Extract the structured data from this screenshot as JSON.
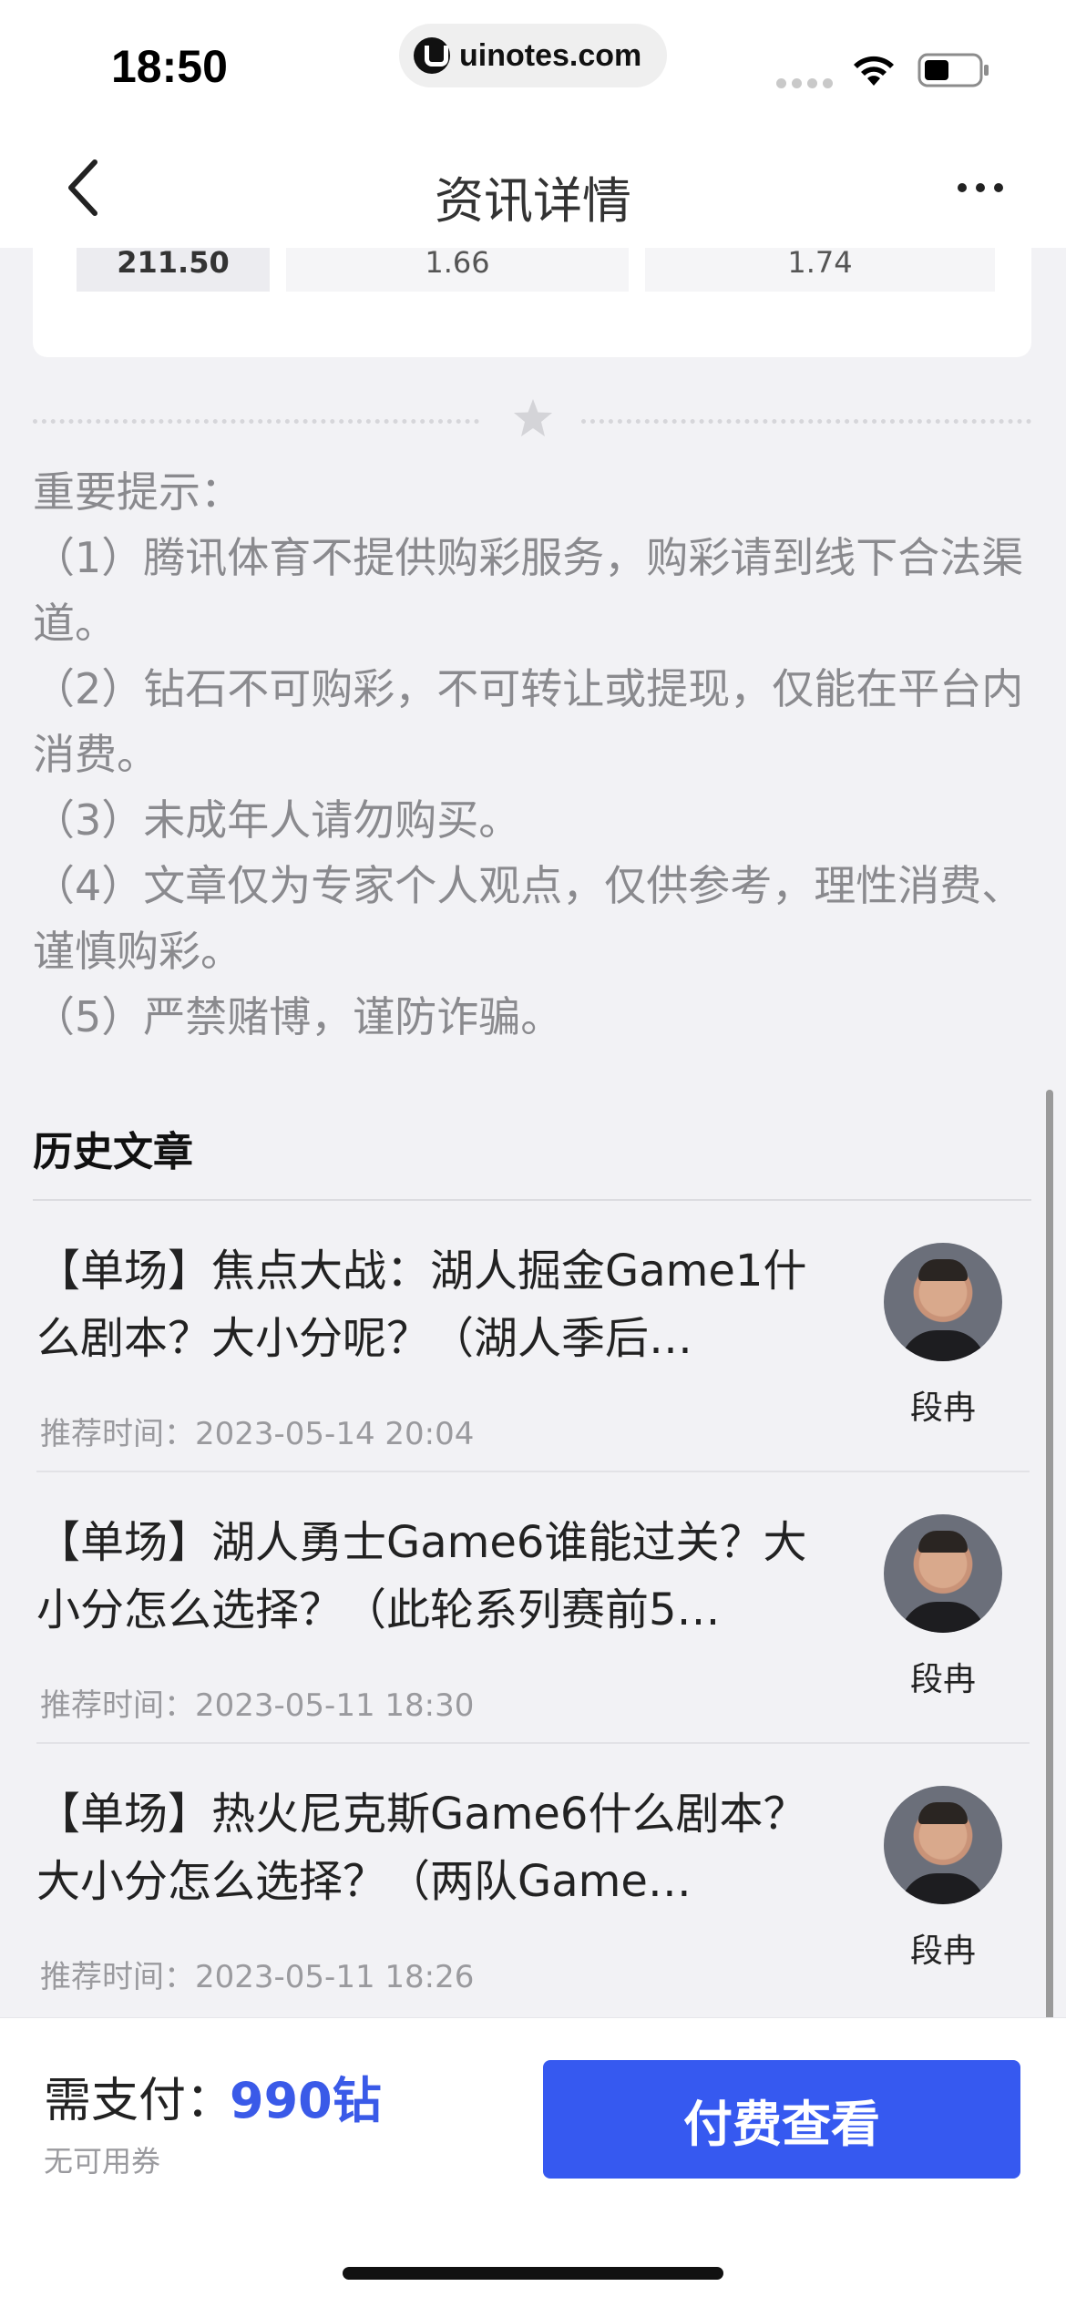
{
  "status_bar": {
    "time": "18:50",
    "url": "uinotes.com"
  },
  "nav": {
    "title": "资讯详情"
  },
  "odds_row": [
    "211.50",
    "1.66",
    "1.74"
  ],
  "notice": {
    "lines": [
      "重要提示：",
      "（1）腾讯体育不提供购彩服务，购彩请到线下合法渠道。",
      "（2）钻石不可购彩，不可转让或提现，仅能在平台内消费。",
      "（3）未成年人请勿购买。",
      "（4）文章仅为专家个人观点，仅供参考，理性消费、谨慎购彩。",
      "（5）严禁赌博，谨防诈骗。"
    ]
  },
  "history": {
    "title": "历史文章",
    "articles": [
      {
        "title": "【单场】焦点大战：湖人掘金Game1什么剧本？大小分呢？（湖人季后…",
        "time": "推荐时间：2023-05-14 20:04",
        "author": "段冉"
      },
      {
        "title": "【单场】湖人勇士Game6谁能过关？大小分怎么选择？（此轮系列赛前5…",
        "time": "推荐时间：2023-05-11 18:30",
        "author": "段冉"
      },
      {
        "title": "【单场】热火尼克斯Game6什么剧本？大小分怎么选择？（两队Game…",
        "time": "推荐时间：2023-05-11 18:26",
        "author": "段冉"
      }
    ]
  },
  "bottom": {
    "pay_label": "需支付：",
    "pay_amount": "990钻",
    "coupon_note": "无可用券",
    "pay_button": "付费查看"
  },
  "colors": {
    "accent": "#3659f0",
    "amount": "#3a5ae8",
    "notice_text": "#8a8a8e"
  },
  "icons": [
    "back-icon",
    "more-icon",
    "wifi-icon",
    "battery-icon",
    "star-icon",
    "avatar"
  ]
}
